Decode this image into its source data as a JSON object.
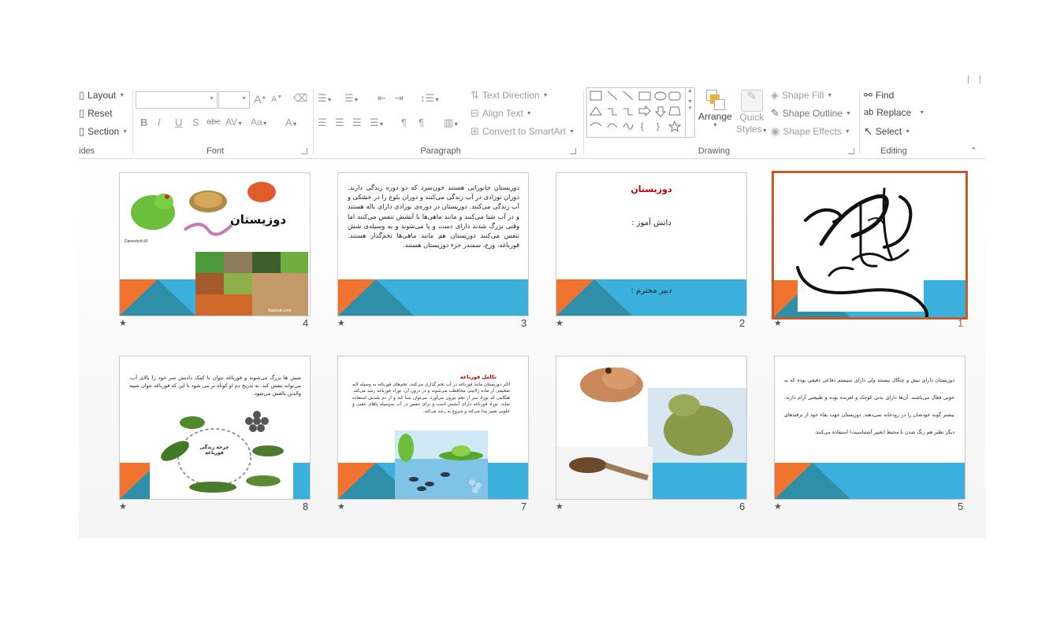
{
  "ribbon": {
    "slides_group": {
      "layout": "Layout",
      "reset": "Reset",
      "section": "Section",
      "label": "ides"
    },
    "font_group": {
      "label": "Font",
      "bold": "B",
      "italic": "I",
      "underline": "U",
      "shadow": "S",
      "strike": "abc",
      "spacing": "AV",
      "case": "Aa",
      "grow": "A",
      "shrink": "A",
      "color": "A"
    },
    "paragraph_group": {
      "label": "Paragraph",
      "text_direction": "Text Direction",
      "align_text": "Align Text",
      "convert_smartart": "Convert to SmartArt"
    },
    "drawing_group": {
      "label": "Drawing",
      "arrange": "Arrange",
      "quick_styles": [
        "Quick",
        "Styles"
      ],
      "shape_fill": "Shape Fill",
      "shape_outline": "Shape Outline",
      "shape_effects": "Shape Effects"
    },
    "editing_group": {
      "label": "Editing",
      "find": "Find",
      "replace": "Replace",
      "select": "Select"
    }
  },
  "slides": [
    {
      "number": "1",
      "star": "★",
      "selected": true
    },
    {
      "number": "2",
      "star": "★",
      "title": "دوزیستان",
      "student": "دانش آموز :",
      "teacher": "دبیر محترم :"
    },
    {
      "number": "3",
      "star": "★",
      "body": "دوزیستان جانورانی هستند خون‌سرد که دو دوره زندگی دارند. دوران نوزادی در آب زندگی می‌کنند و دوران بلوغ را در خشکی و آب زندگی می‌کنند. دوزیستان در دوره‌ی نوزادی دارای باله هستند و در آب شنا می‌کنند و مانند ماهی‌ها با آبشش تنفس می‌کنند اما وقتی بزرگ شدند دارای دست و پا می‌شوند و به وسیله‌ی شش تنفس می‌کنند دوزیستان هم مانند ماهی‌ها تخم‌گذار هستند. قورباغه، وزغ، سمندر جزء دوزیستان هستند."
    },
    {
      "number": "4",
      "star": "★",
      "caption": "دوزیستان",
      "site1": "Daneshchi.iR",
      "site2": "Namnak.com"
    },
    {
      "number": "5",
      "star": "★",
      "body": "دوزیستان دارای نیش و چنگال نیستند ولی دارای سیستم دفاعی دقیقی بوده که به خوبی فعال می‌باشند. آن‌ها دارای بدنی کوچک و لغزنده بوده و طبیعتی آرام دارند. بیشتر گونه خودشان را در رودخانه نمی‌دهند. دوزیستان جهت بقاء خود از ترفندهای دیگر نظیر هم رنگ شدن با محیط (تغییر آشتباسیت) استفاده می‌کنند."
    },
    {
      "number": "6",
      "star": "★"
    },
    {
      "number": "7",
      "star": "★",
      "title": "تکامل قورباغه",
      "body": "اکثر دوزیستان مانند قورباغه در آب تخم گذاری می‌کنند. تخم‌های قورباغه به وسیله لایه ضخیمی از ماده ژلاتینی محافظت می‌شوند و در درون آن، نوزاد قورباغه رشد می‌کند. هنگامی که نوزاد سر از تخم بیرون می‌آورد، می‌توان شنا کند و از دم بلندش استفاده نماید. نوزاد قورباغه دارای آبشش است و برای تنفس در آب به‌وسیله پاهای عقبی و جلویی تغییر پیدا می‌کند و شروع به رشد می‌کند."
    },
    {
      "number": "8",
      "star": "★",
      "body": "شش ها بزرگ می‌شوند و قورباغه جوان با کمک دادنش سر خود را بالای آب، می‌تواند تنفس کند. به تدریج دم او کوتاه تر می شود تا این که قورباغه جوان شبیه والدین بالغش می‌شود.",
      "cycle_label": "چرخه زندگی قورباغه"
    }
  ],
  "colors": {
    "accent_orange": "#f07330",
    "accent_blue": "#3bb0dc",
    "accent_teal": "#2f8fa8",
    "selected_border": "#c55a2a",
    "title_red": "#c00000"
  }
}
